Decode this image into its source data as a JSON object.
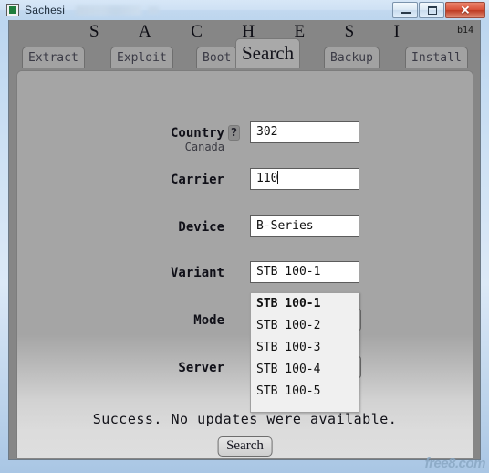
{
  "window": {
    "title": "Sachesi",
    "icon": "app-icon",
    "buttons": {
      "minimize": "–",
      "maximize": "□",
      "close": "✕"
    }
  },
  "header": {
    "brand_letters": [
      "S",
      "A",
      "C",
      "H",
      "E",
      "S",
      "I"
    ],
    "version": "b14"
  },
  "tabs": [
    {
      "label": "Extract",
      "active": false
    },
    {
      "label": "Exploit",
      "active": false
    },
    {
      "label": "Boot",
      "active": false
    },
    {
      "label": "Search",
      "active": true
    },
    {
      "label": "Backup",
      "active": false
    },
    {
      "label": "Install",
      "active": false
    }
  ],
  "form": {
    "country": {
      "label": "Country",
      "help_icon": "question-mark-icon",
      "help_glyph": "?",
      "value": "302",
      "resolved": "Canada"
    },
    "carrier": {
      "label": "Carrier",
      "value": "110",
      "has_caret": true
    },
    "device": {
      "label": "Device",
      "value": "B-Series"
    },
    "variant": {
      "label": "Variant",
      "value": "STB 100-1",
      "expanded": true,
      "options": [
        "STB 100-1",
        "STB 100-2",
        "STB 100-3",
        "STB 100-4",
        "STB 100-5"
      ],
      "selected_index": 0
    },
    "mode": {
      "label": "Mode"
    },
    "server": {
      "label": "Server"
    }
  },
  "status": {
    "message": "Success.  No updates were available.",
    "search_button": "Search"
  },
  "watermark": "free8.com",
  "colors": {
    "header_band": "#868686",
    "panel": "#a5a5a5",
    "panel_bottom": "#dedede",
    "field_bg": "#ffffff",
    "dropdown_bg": "#f0f0f0",
    "titlebar": "#cfe1f4",
    "close_button": "#d9523a",
    "watermark": "#8aa8c4"
  }
}
